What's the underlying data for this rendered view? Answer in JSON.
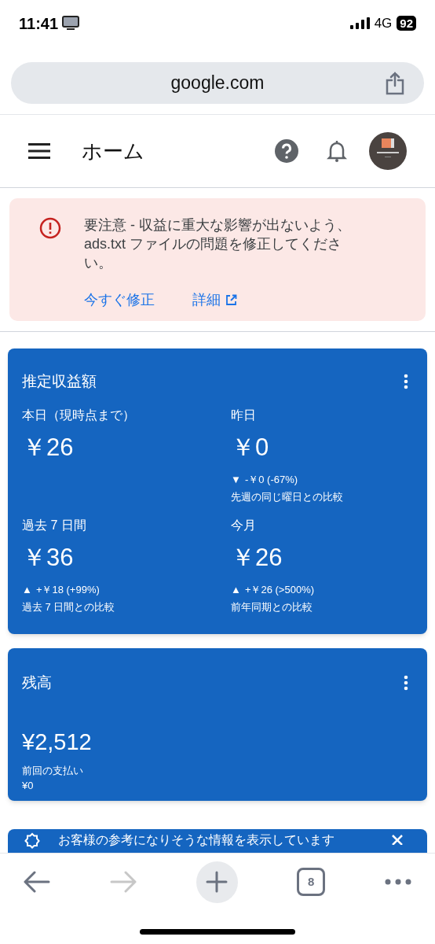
{
  "status_bar": {
    "time": "11:41",
    "network": "4G",
    "battery": "92"
  },
  "address_bar": {
    "url": "google.com"
  },
  "header": {
    "title": "ホーム"
  },
  "alert": {
    "message": "要注意 - 収益に重大な影響が出ないよう、ads.txt ファイルの問題を修正してください。",
    "actions": [
      {
        "label": "今すぐ修正",
        "external": false
      },
      {
        "label": "詳細",
        "external": true
      }
    ]
  },
  "earnings_card": {
    "title": "推定収益額",
    "metrics": [
      {
        "label": "本日（現時点まで）",
        "value": "￥26"
      },
      {
        "label": "昨日",
        "value": "￥0",
        "trend_mark": "▼",
        "change": "-￥0 (-67%)",
        "comparison": "先週の同じ曜日との比較"
      },
      {
        "label": "過去 7 日間",
        "value": "￥36",
        "trend_mark": "▲",
        "change": "+￥18 (+99%)",
        "comparison": "過去 7 日間との比較"
      },
      {
        "label": "今月",
        "value": "￥26",
        "trend_mark": "▲",
        "change": "+￥26 (>500%)",
        "comparison": "前年同期との比較"
      }
    ]
  },
  "balance_card": {
    "title": "残高",
    "value": "¥2,512",
    "last_payment_label": "前回の支払い",
    "last_payment_value": "¥0"
  },
  "info_banner": {
    "message": "お客様の参考になりそうな情報を表示しています"
  },
  "toolbar": {
    "tab_count": "8",
    "forward_disabled": true
  }
}
